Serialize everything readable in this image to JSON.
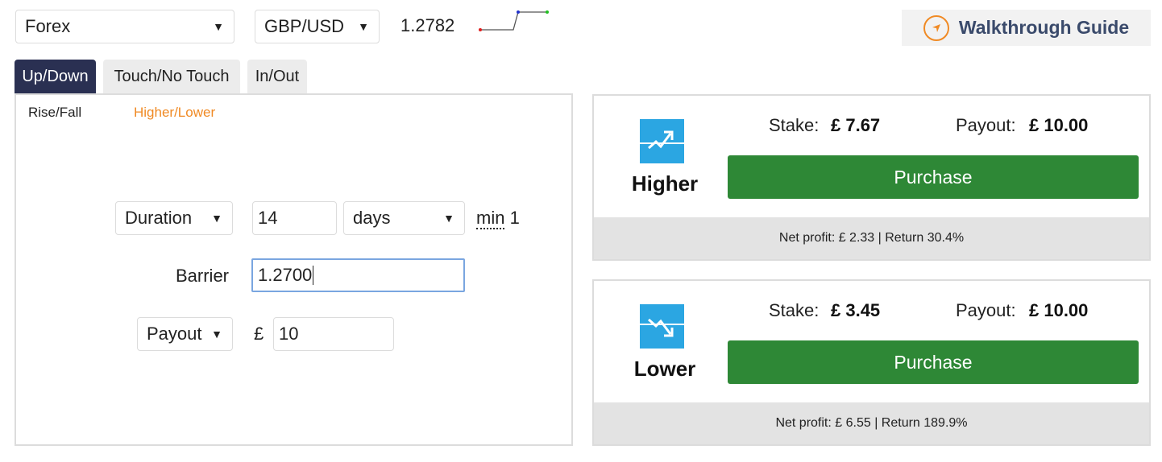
{
  "header": {
    "market": "Forex",
    "symbol": "GBP/USD",
    "spot_price": "1.2782",
    "walkthrough_label": "Walkthrough Guide"
  },
  "tabs": [
    {
      "label": "Up/Down",
      "active": true
    },
    {
      "label": "Touch/No Touch",
      "active": false
    },
    {
      "label": "In/Out",
      "active": false
    }
  ],
  "subtabs": [
    {
      "label": "Rise/Fall",
      "active": false
    },
    {
      "label": "Higher/Lower",
      "active": true
    }
  ],
  "form": {
    "duration_type": "Duration",
    "duration_value": "14",
    "duration_unit": "days",
    "min_label": "min",
    "min_value": "1",
    "barrier_label": "Barrier",
    "barrier_value": "1.2700",
    "amount_type": "Payout",
    "currency_symbol": "£",
    "amount_value": "10"
  },
  "contracts": [
    {
      "direction": "Higher",
      "stake_label": "Stake:",
      "stake": "£ 7.67",
      "payout_label": "Payout:",
      "payout": "£ 10.00",
      "purchase_label": "Purchase",
      "footer": "Net profit: £ 2.33 | Return 30.4%"
    },
    {
      "direction": "Lower",
      "stake_label": "Stake:",
      "stake": "£ 3.45",
      "payout_label": "Payout:",
      "payout": "£ 10.00",
      "purchase_label": "Purchase",
      "footer": "Net profit: £ 6.55 | Return 189.9%"
    }
  ],
  "colors": {
    "accent_orange": "#f08a24",
    "tab_active_bg": "#2a3052",
    "purchase_green": "#2e8836",
    "contract_icon_blue": "#2ba6e2"
  },
  "icons": {
    "dropdown": "caret-down-icon",
    "walkthrough": "navigation-arrow-icon",
    "higher": "trend-up-icon",
    "lower": "trend-down-icon"
  }
}
